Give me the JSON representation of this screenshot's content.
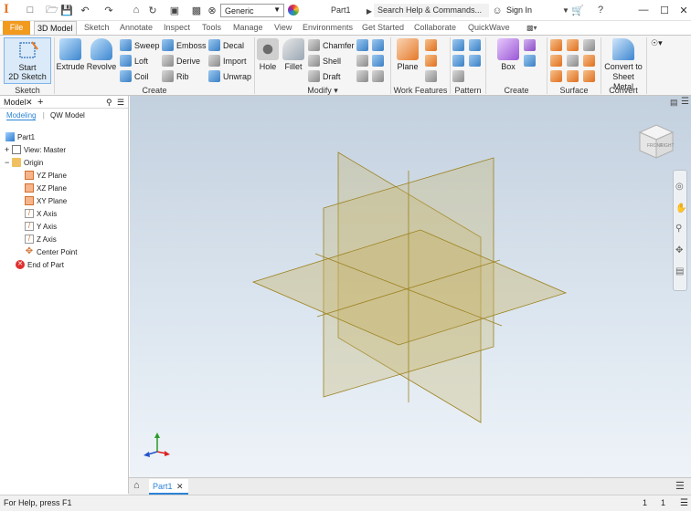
{
  "titlebar": {
    "profile": "Generic",
    "document_title": "Part1",
    "search_placeholder": "Search Help & Commands...",
    "signin": "Sign In"
  },
  "tabs": [
    "File",
    "3D Model",
    "Sketch",
    "Annotate",
    "Inspect",
    "Tools",
    "Manage",
    "View",
    "Environments",
    "Get Started",
    "Collaborate",
    "QuickWave"
  ],
  "active_tab": "3D Model",
  "ribbon": {
    "sketch": {
      "start_line1": "Start",
      "start_line2": "2D Sketch",
      "label": "Sketch"
    },
    "create": {
      "extrude": "Extrude",
      "revolve": "Revolve",
      "sweep": "Sweep",
      "loft": "Loft",
      "coil": "Coil",
      "emboss": "Emboss",
      "derive": "Derive",
      "rib": "Rib",
      "decal": "Decal",
      "import": "Import",
      "unwrap": "Unwrap",
      "label": "Create"
    },
    "modify": {
      "hole": "Hole",
      "fillet": "Fillet",
      "chamfer": "Chamfer",
      "shell": "Shell",
      "draft": "Draft",
      "label": "Modify ▾"
    },
    "work_features": {
      "plane": "Plane",
      "label": "Work Features"
    },
    "pattern": {
      "label": "Pattern"
    },
    "freeform": {
      "box": "Box",
      "label": "Create Freeform"
    },
    "surface": {
      "label": "Surface"
    },
    "convert": {
      "line1": "Convert to",
      "line2": "Sheet Metal",
      "label": "Convert"
    }
  },
  "browser": {
    "title": "Model",
    "subtabs": [
      "Modeling",
      "QW Model"
    ],
    "tree": [
      {
        "label": "Part1"
      },
      {
        "label": "View: Master"
      },
      {
        "label": "Origin"
      },
      {
        "label": "YZ Plane"
      },
      {
        "label": "XZ Plane"
      },
      {
        "label": "XY Plane"
      },
      {
        "label": "X Axis"
      },
      {
        "label": "Y Axis"
      },
      {
        "label": "Z Axis"
      },
      {
        "label": "Center Point"
      },
      {
        "label": "End of Part"
      }
    ]
  },
  "viewcube": {
    "front": "FRONT",
    "right": "RIGHT"
  },
  "doc_tab": "Part1",
  "status": {
    "help": "For Help, press F1",
    "count1": "1",
    "count2": "1"
  },
  "colors": {
    "file_tab": "#f29a1e",
    "accent": "#2b84d6",
    "plane_fill": "#c8b46a",
    "plane_edge": "#9c8220"
  }
}
